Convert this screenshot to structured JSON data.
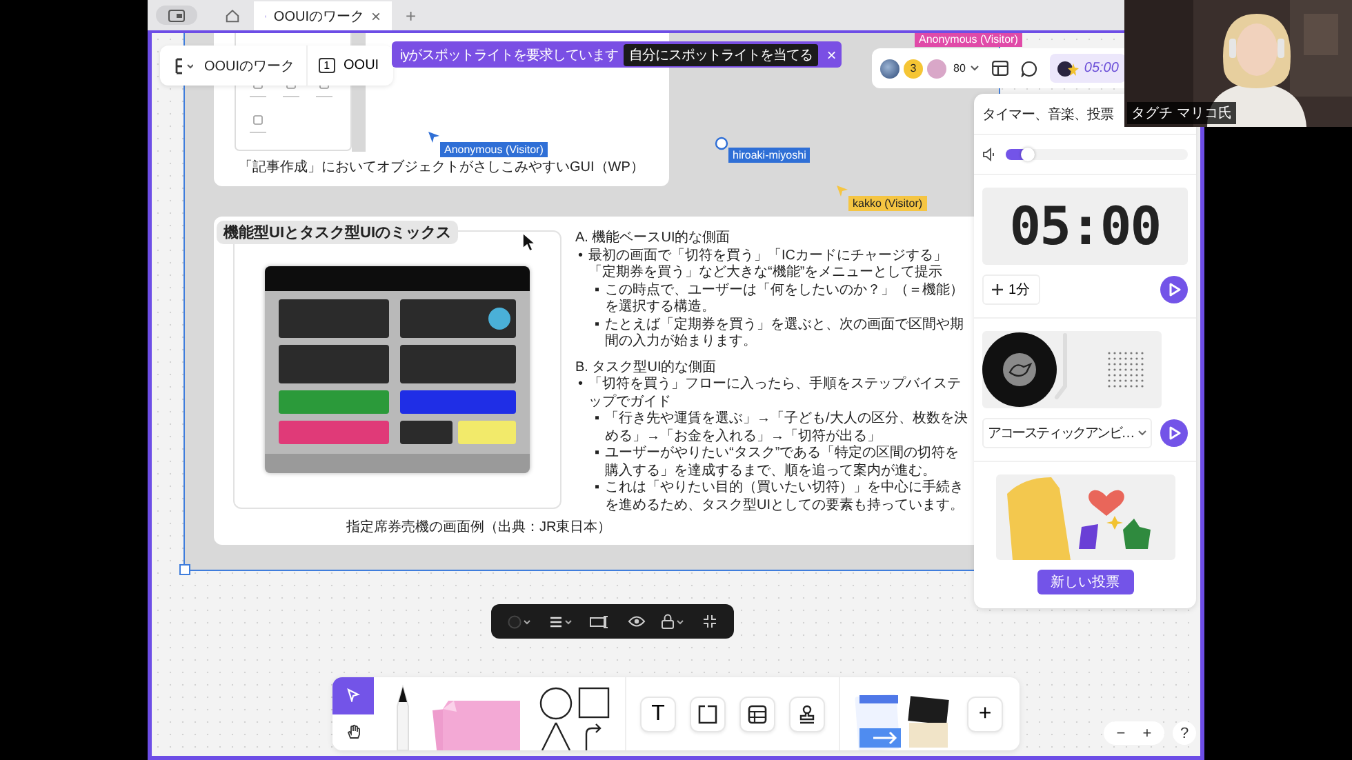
{
  "browser": {
    "tabs": [
      {
        "title": "OOUIのワーク",
        "selected": true
      }
    ],
    "close": "×",
    "new_tab": "+"
  },
  "board_menu": {
    "board_name": "OOUIのワーク",
    "frame_count": "1",
    "frame_name": "OOUI"
  },
  "spotlight": {
    "message": "iyがスポットライトを要求しています",
    "action": "自分にスポットライトを当てる",
    "close": "×"
  },
  "collaborators": {
    "count": "3",
    "zoom": "80",
    "timer": "05:00"
  },
  "cursors": [
    {
      "name": "Anonymous (Visitor)",
      "kind": "label",
      "color": "#e04aa8"
    },
    {
      "name": "Anonymous (Visitor)",
      "kind": "arrow",
      "color": "#2f6fd6"
    },
    {
      "name": "hiroaki-miyoshi",
      "kind": "hand",
      "color": "#2f6fd6"
    },
    {
      "name": "kakko (Visitor)",
      "kind": "arrow",
      "color": "#f5c542"
    }
  ],
  "top_card": {
    "caption": "「記事作成」においてオブジェクトがさしこみやすいGUI（WP）"
  },
  "mix_card": {
    "title": "機能型UIとタスク型UIのミックス",
    "caption": "指定席券売機の画面例（出典：JR東日本）",
    "sections": [
      {
        "heading": "A. 機能ベースUI的な側面",
        "items": [
          {
            "bullet": "•",
            "text": "最初の画面で「切符を買う」「ICカードにチャージする」「定期券を買う」など大きな“機能”をメニューとして提示",
            "children": [
              {
                "bullet": "▪",
                "text": "この時点で、ユーザーは「何をしたいのか？」（＝機能）を選択する構造。"
              },
              {
                "bullet": "▪",
                "text": "たとえば「定期券を買う」を選ぶと、次の画面で区間や期間の入力が始まります。"
              }
            ]
          }
        ]
      },
      {
        "heading": "B. タスク型UI的な側面",
        "items": [
          {
            "bullet": "•",
            "text": "「切符を買う」フローに入ったら、手順をステップバイステップでガイド",
            "children": [
              {
                "bullet": "▪",
                "text": "「行き先や運賃を選ぶ」→「子ども/大人の区分、枚数を決める」→「お金を入れる」→「切符が出る」"
              },
              {
                "bullet": "▪",
                "text": "ユーザーがやりたい“タスク”である「特定の区間の切符を購入する」を達成するまで、順を追って案内が進む。"
              },
              {
                "bullet": "▪",
                "text": "これは「やりたい目的（買いたい切符）」を中心に手続きを進めるため、タスク型UIとしての要素も持っています。"
              }
            ]
          }
        ]
      }
    ]
  },
  "panel": {
    "title": "タイマー、音楽、投票",
    "volume": {
      "level": 0.12
    },
    "timer": {
      "display": "05:00",
      "add_label": "1分"
    },
    "music": {
      "track": "アコースティックアンビ…"
    },
    "poll": {
      "button": "新しい投票"
    }
  },
  "tools": [
    {
      "kind": "select",
      "selected": true
    },
    {
      "kind": "hand",
      "selected": false
    }
  ],
  "insert_tools": [
    {
      "kind": "pen"
    },
    {
      "kind": "sticky"
    },
    {
      "kind": "shapes"
    },
    {
      "kind": "text",
      "label": "T"
    },
    {
      "kind": "frame"
    },
    {
      "kind": "table"
    },
    {
      "kind": "stamp"
    },
    {
      "kind": "templates"
    },
    {
      "kind": "more",
      "label": "+"
    }
  ],
  "zoom_controls": {
    "zoom_out": "−",
    "zoom_in": "+",
    "help": "?"
  },
  "webcam": {
    "name": "タグチ マリコ氏"
  }
}
